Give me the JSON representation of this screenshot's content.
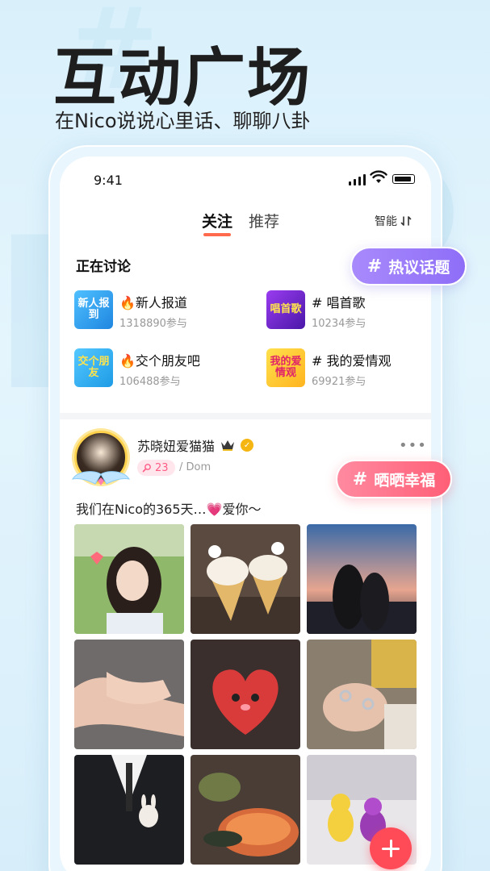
{
  "hero": {
    "title": "互动广场",
    "subtitle": "在Nico说说心里话、聊聊八卦"
  },
  "status_bar": {
    "time": "9:41"
  },
  "feed_tabs": {
    "follow": "关注",
    "recommend": "推荐",
    "active": "follow",
    "sort_label": "智能",
    "sort_icon": "sort-arrows-icon"
  },
  "discussion": {
    "title": "正在讨论",
    "topics": [
      {
        "name": "🔥新人报道",
        "count": "1318890参与",
        "thumb_text": "新人报到",
        "color": "#2b9df0"
      },
      {
        "name": "# 唱首歌",
        "count": "10234参与",
        "thumb_text": "唱首歌",
        "color": "#6a2bd4"
      },
      {
        "name": "🔥交个朋友吧",
        "count": "106488参与",
        "thumb_text": "交个朋友",
        "color": "#2ea6ee"
      },
      {
        "name": "# 我的爱情观",
        "count": "69921参与",
        "thumb_text": "我的爱情观",
        "color": "#ffcf2b"
      }
    ]
  },
  "floating_tags": {
    "hot_topic": "热议话题",
    "happiness": "晒晒幸福",
    "hash_icon": "hash-icon"
  },
  "post": {
    "username": "苏晓妞爱猫猫",
    "level": "23",
    "location_sep": "/",
    "location": "Dom",
    "text": "我们在Nico的365天…💗爱你～",
    "more": "•••",
    "photos": [
      "girl-portrait",
      "ice-cream-cones",
      "sunset-couple",
      "holding-hands",
      "heart-plush",
      "ringed-hands",
      "suit-with-bunny-pin",
      "hotpot-meal",
      "gummy-bears"
    ]
  },
  "colors": {
    "accent_orange": "#ff6a4d",
    "tag_purple": "#8e6ef7",
    "tag_pink": "#ff5f77",
    "fab_red": "#ff4a57",
    "bg": "#e4f5fd"
  },
  "fab": {
    "icon": "plus-icon"
  }
}
